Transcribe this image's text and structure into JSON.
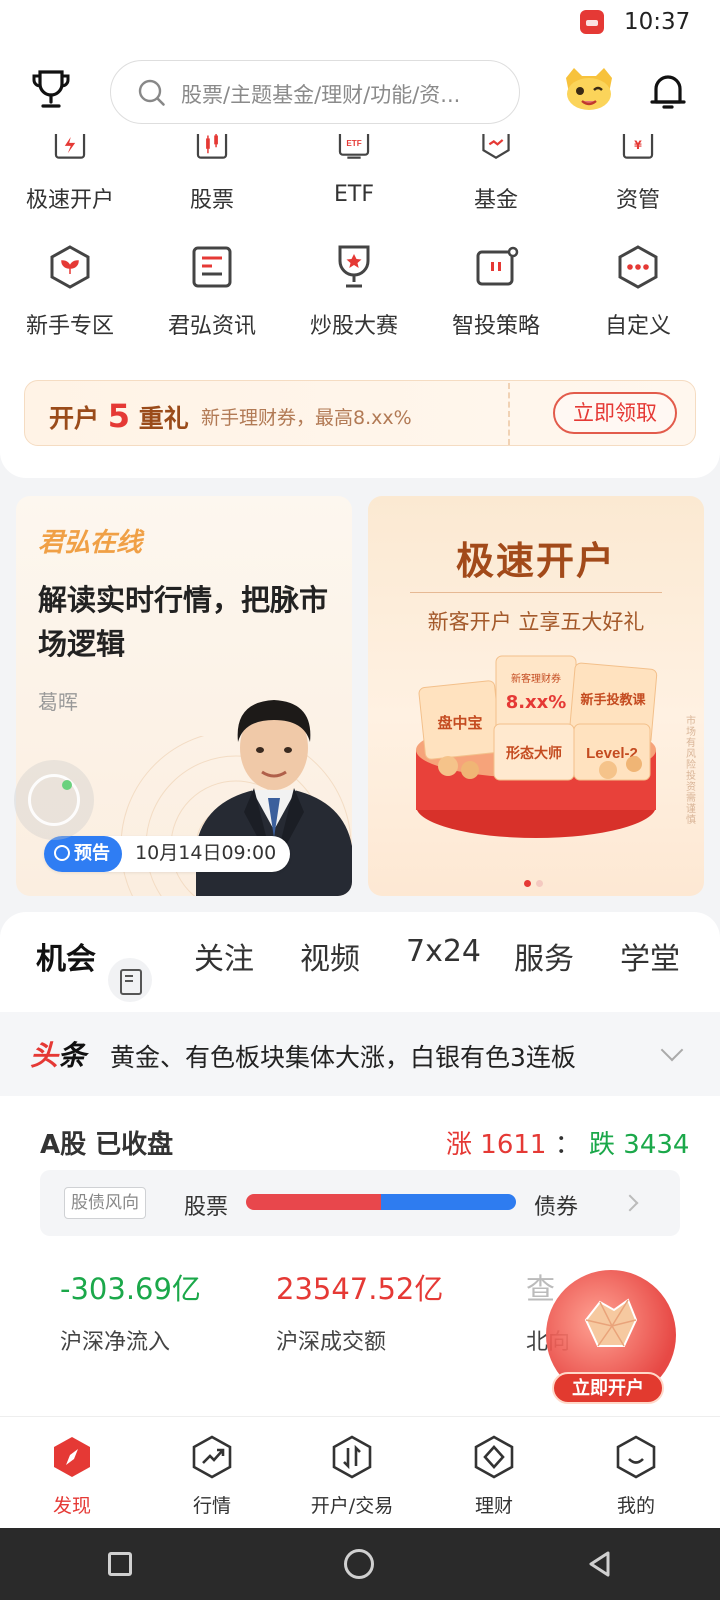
{
  "status_bar": {
    "time": "10:37"
  },
  "header": {
    "search_placeholder": "股票/主题基金/理财/功能/资..."
  },
  "quick_grid": {
    "row1": [
      {
        "label": "极速开户",
        "icon": "account-open-icon"
      },
      {
        "label": "股票",
        "icon": "stock-candle-icon"
      },
      {
        "label": "ETF",
        "icon": "etf-icon"
      },
      {
        "label": "基金",
        "icon": "fund-icon"
      },
      {
        "label": "资管",
        "icon": "asset-management-icon"
      }
    ],
    "row2": [
      {
        "label": "新手专区",
        "icon": "newbie-icon"
      },
      {
        "label": "君弘资讯",
        "icon": "news-doc-icon"
      },
      {
        "label": "炒股大赛",
        "icon": "contest-trophy-icon"
      },
      {
        "label": "智投策略",
        "icon": "strategy-icon"
      },
      {
        "label": "自定义",
        "icon": "custom-dots-icon"
      }
    ]
  },
  "promo": {
    "prefix": "开户",
    "number": "5",
    "suffix": "重礼",
    "desc": "新手理财券，最高8.xx%",
    "button": "立即领取"
  },
  "live_card": {
    "brand": "君弘在线",
    "title": "解读实时行情，把脉市场逻辑",
    "author": "葛晖",
    "notice_tag": "预告",
    "notice_time": "10月14日09:00"
  },
  "account_banner": {
    "title": "极速开户",
    "subtitle": "新客开户 立享五大好礼",
    "gift_cards": [
      "盘中宝",
      "新客理财券 8.xx%",
      "新手投教课",
      "形态大师",
      "Level-2"
    ],
    "side_note": "市场有风险 投资需谨慎"
  },
  "content_tabs": {
    "items": [
      "机会",
      "关注",
      "视频",
      "7x24",
      "服务",
      "学堂"
    ],
    "active": "机会"
  },
  "headline": {
    "tag_left": "头",
    "tag_right": "条",
    "text": "黄金、有色板块集体大涨，白银有色3连板"
  },
  "market": {
    "title": "A股 已收盘",
    "up_label": "涨",
    "up_count": "1611",
    "sep": "：",
    "down_label": "跌",
    "down_count": "3434",
    "flow_chip": "股债风向",
    "flow_left": "股票",
    "flow_right": "债券",
    "flow_stock_share": 0.5,
    "stats": [
      {
        "value": "-303.69亿",
        "label": "沪深净流入",
        "color": "#1ba84a"
      },
      {
        "value": "23547.52亿",
        "label": "沪深成交额",
        "color": "#e53935"
      },
      {
        "value": "查",
        "label": "北向",
        "color": "#bbbbbb"
      }
    ]
  },
  "float_open": {
    "button": "立即开户"
  },
  "bottom_nav": {
    "items": [
      {
        "label": "发现",
        "icon": "discover-compass-icon"
      },
      {
        "label": "行情",
        "icon": "market-trend-icon"
      },
      {
        "label": "开户/交易",
        "icon": "trade-exchange-icon"
      },
      {
        "label": "理财",
        "icon": "wealth-diamond-icon"
      },
      {
        "label": "我的",
        "icon": "profile-smile-icon"
      }
    ],
    "active": "发现"
  },
  "colors": {
    "brand_red": "#e53935",
    "up_red": "#e53935",
    "down_green": "#1ba84a",
    "flow_blue": "#2e7cf0"
  }
}
